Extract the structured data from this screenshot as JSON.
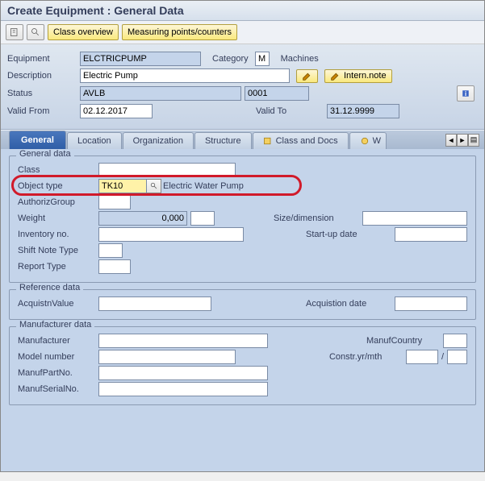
{
  "title": "Create Equipment : General Data",
  "toolbar": {
    "class_overview": "Class overview",
    "measuring_points": "Measuring points/counters"
  },
  "header": {
    "equipment_lbl": "Equipment",
    "equipment_val": "ELCTRICPUMP",
    "category_lbl": "Category",
    "category_val": "M",
    "category_txt": "Machines",
    "description_lbl": "Description",
    "description_val": "Electric Pump",
    "intern_note": "Intern.note",
    "status_lbl": "Status",
    "status_val": "AVLB",
    "status_code": "0001",
    "valid_from_lbl": "Valid From",
    "valid_from_val": "02.12.2017",
    "valid_to_lbl": "Valid To",
    "valid_to_val": "31.12.9999"
  },
  "tabs": [
    "General",
    "Location",
    "Organization",
    "Structure",
    "Class and Docs",
    "W"
  ],
  "general_data": {
    "legend": "General data",
    "class_lbl": "Class",
    "class_val": "",
    "object_type_lbl": "Object type",
    "object_type_val": "TK10",
    "object_type_txt": "Electric Water Pump",
    "authgrp_lbl": "AuthorizGroup",
    "authgrp_val": "",
    "weight_lbl": "Weight",
    "weight_val": "0,000",
    "weight_unit": "",
    "size_lbl": "Size/dimension",
    "size_val": "",
    "inv_lbl": "Inventory no.",
    "inv_val": "",
    "startup_lbl": "Start-up date",
    "startup_val": "",
    "shift_lbl": "Shift Note Type",
    "shift_val": "",
    "report_lbl": "Report Type",
    "report_val": ""
  },
  "reference_data": {
    "legend": "Reference data",
    "acq_val_lbl": "AcquistnValue",
    "acq_val": "",
    "acq_date_lbl": "Acquistion date",
    "acq_date": ""
  },
  "manufacturer_data": {
    "legend": "Manufacturer data",
    "manuf_lbl": "Manufacturer",
    "manuf_val": "",
    "country_lbl": "ManufCountry",
    "country_val": "",
    "model_lbl": "Model number",
    "model_val": "",
    "constr_lbl": "Constr.yr/mth",
    "constr_yr": "",
    "constr_mth": "",
    "part_lbl": "ManufPartNo.",
    "part_val": "",
    "serial_lbl": "ManufSerialNo.",
    "serial_val": ""
  }
}
